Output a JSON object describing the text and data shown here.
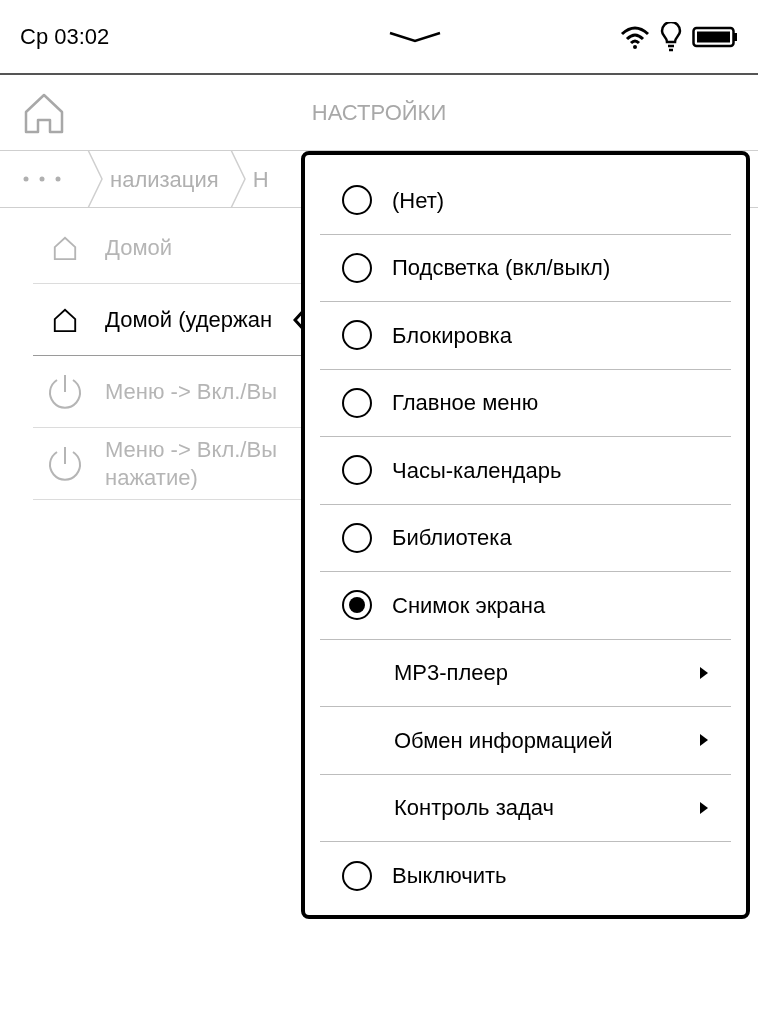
{
  "status_bar": {
    "time": "Ср 03:02"
  },
  "header": {
    "title": "НАСТРОЙКИ"
  },
  "breadcrumbs": [
    "нализация",
    "Н"
  ],
  "settings": [
    {
      "kind": "home",
      "lines": [
        "Домой"
      ],
      "selected": false
    },
    {
      "kind": "home",
      "lines": [
        "Домой (удержан"
      ],
      "selected": true
    },
    {
      "kind": "power",
      "lines": [
        "Меню -> Вкл./Вы"
      ],
      "selected": false
    },
    {
      "kind": "power",
      "lines": [
        "Меню -> Вкл./Вы",
        "нажатие)"
      ],
      "selected": false
    }
  ],
  "menu": [
    {
      "kind": "radio",
      "label": "(Нет)",
      "selected": false
    },
    {
      "kind": "radio",
      "label": "Подсветка (вкл/выкл)",
      "selected": false
    },
    {
      "kind": "radio",
      "label": "Блокировка",
      "selected": false
    },
    {
      "kind": "radio",
      "label": "Главное меню",
      "selected": false
    },
    {
      "kind": "radio",
      "label": "Часы-календарь",
      "selected": false
    },
    {
      "kind": "radio",
      "label": "Библиотека",
      "selected": false
    },
    {
      "kind": "radio",
      "label": "Снимок экрана",
      "selected": true
    },
    {
      "kind": "submenu",
      "label": "MP3-плеер"
    },
    {
      "kind": "submenu",
      "label": "Обмен информацией"
    },
    {
      "kind": "submenu",
      "label": "Контроль задач"
    },
    {
      "kind": "radio",
      "label": "Выключить",
      "selected": false
    }
  ]
}
